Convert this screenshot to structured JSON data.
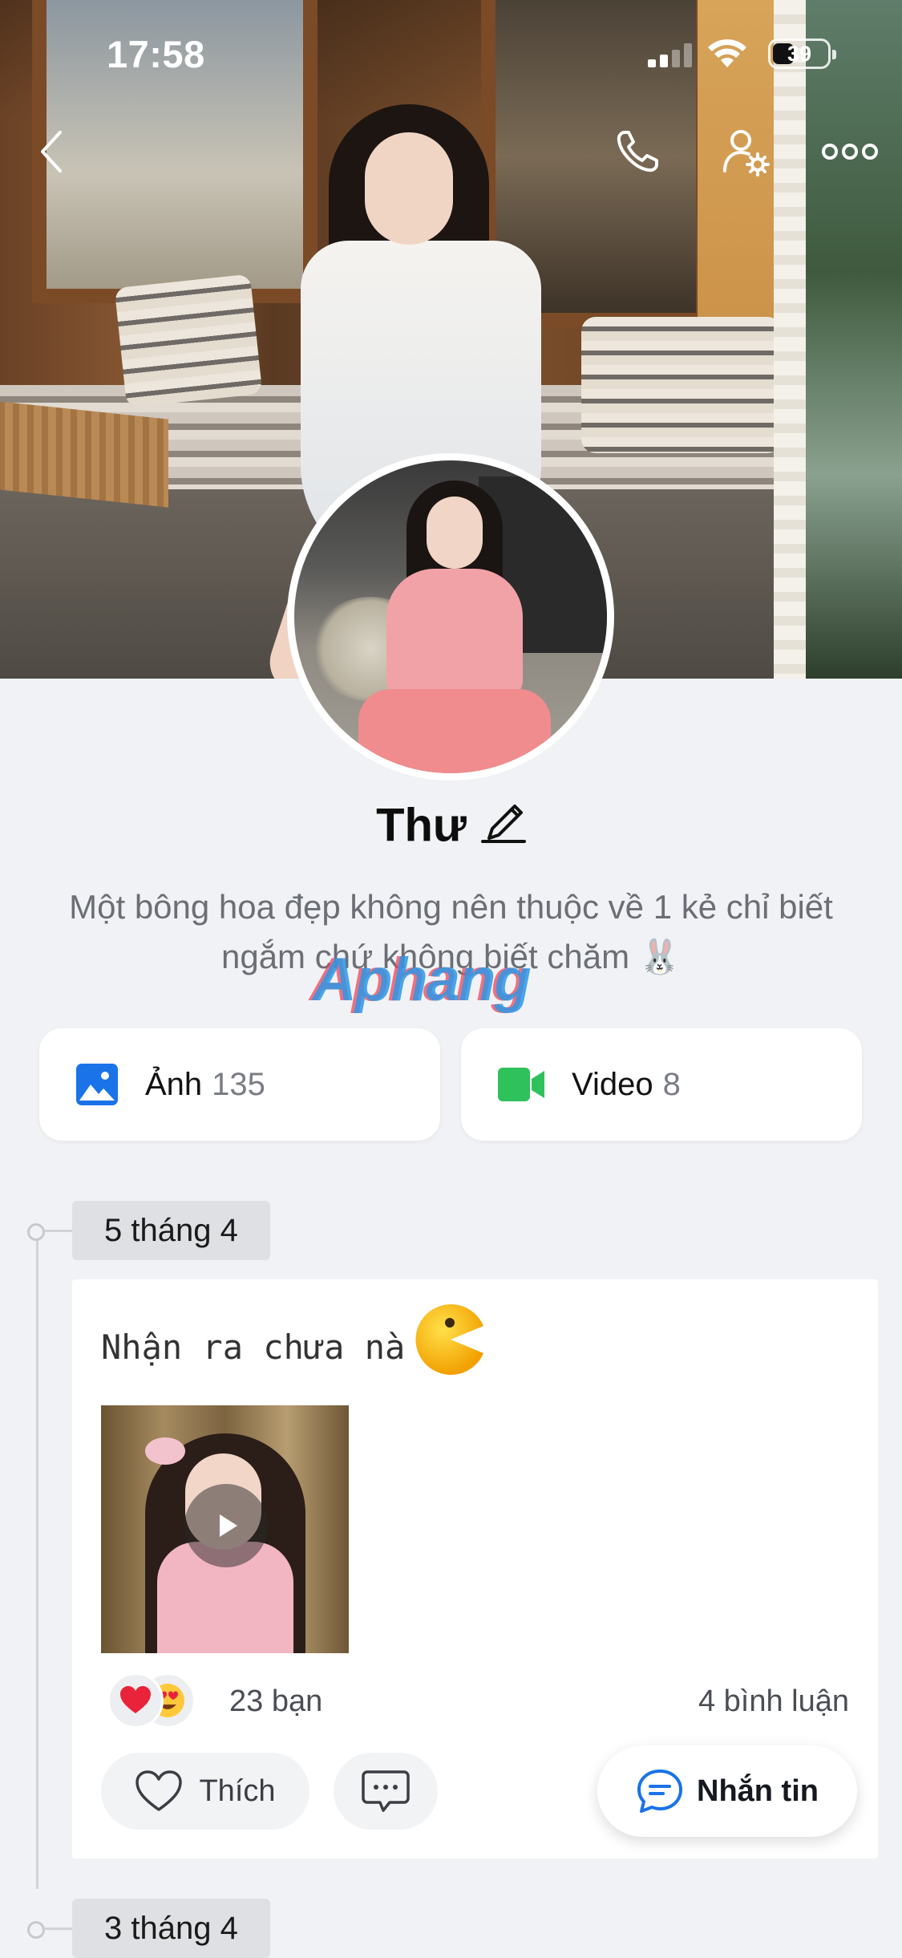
{
  "status_bar": {
    "time": "17:58",
    "battery": "39"
  },
  "profile": {
    "name": "Thư",
    "bio": "Một bông hoa đẹp không nên thuộc về 1 kẻ chỉ biết ngắm chứ không biết chăm 🐰",
    "watermark": "Aphang"
  },
  "media": {
    "photos_label": "Ảnh",
    "photos_count": "135",
    "videos_label": "Video",
    "videos_count": "8"
  },
  "timeline": [
    {
      "date": "5 tháng 4",
      "caption": "Nhận ra chưa nà",
      "reactions_text": "23 bạn",
      "comments_text": "4 bình luận",
      "like_label": "Thích"
    },
    {
      "date": "3 tháng 4"
    }
  ],
  "message_button": "Nhắn tin",
  "icons": {
    "top": [
      "back-icon",
      "phone-icon",
      "user-settings-icon",
      "more-icon"
    ],
    "photo": "image-icon",
    "video": "video-camera-icon"
  },
  "colors": {
    "accent_blue": "#1a73e8",
    "video_green": "#2fc15c",
    "like_red": "#e8233a"
  }
}
